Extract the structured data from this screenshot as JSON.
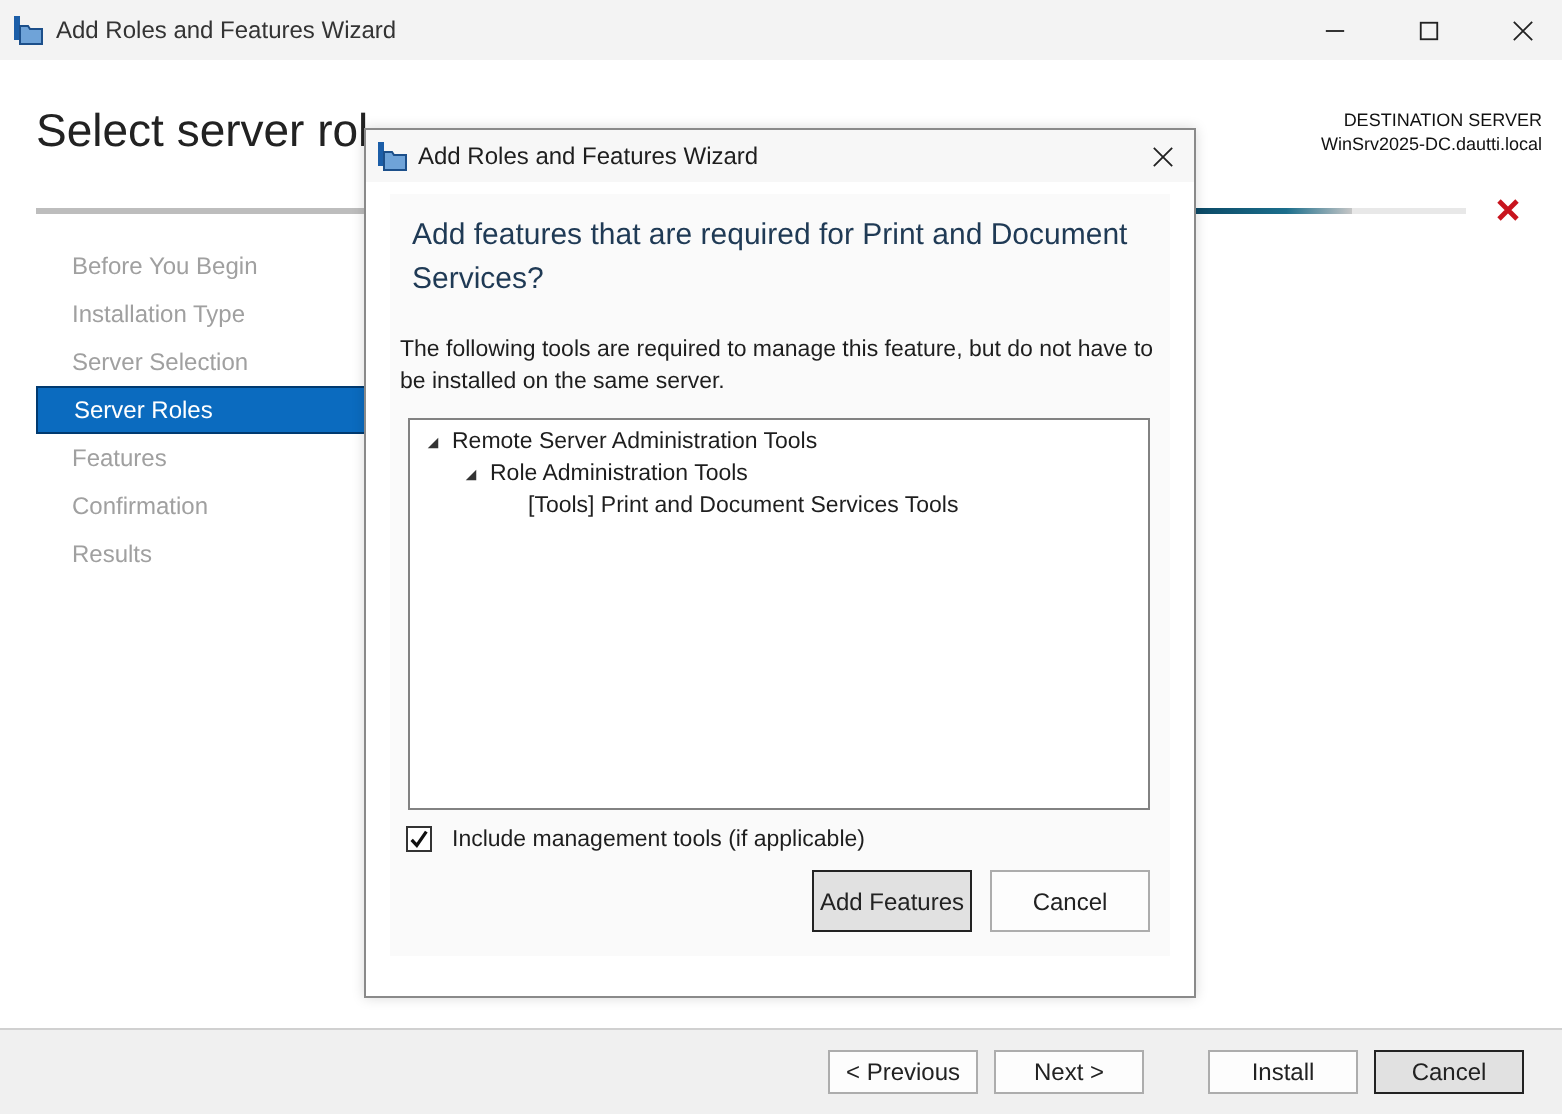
{
  "window": {
    "title": "Add Roles and Features Wizard"
  },
  "header": {
    "title": "Select server rol",
    "destination_label": "DESTINATION SERVER",
    "destination_server": "WinSrv2025-DC.dautti.local",
    "progress": {
      "level": 0.92
    }
  },
  "sidebar": {
    "items": [
      {
        "label": "Before You Begin",
        "selected": false
      },
      {
        "label": "Installation Type",
        "selected": false
      },
      {
        "label": "Server Selection",
        "selected": false
      },
      {
        "label": "Server Roles",
        "selected": true
      },
      {
        "label": "Features",
        "selected": false
      },
      {
        "label": "Confirmation",
        "selected": false
      },
      {
        "label": "Results",
        "selected": false
      }
    ]
  },
  "footer": {
    "buttons": [
      {
        "label": "< Previous",
        "default": false
      },
      {
        "label": "Next >",
        "default": false
      },
      {
        "label": "Install",
        "default": false
      },
      {
        "label": "Cancel",
        "default": true
      }
    ]
  },
  "dialog": {
    "title": "Add Roles and Features Wizard",
    "heading": "Add features that are required for Print and Document Services?",
    "description": "The following tools are required to manage this feature, but do not have to be installed on the same server.",
    "tree": [
      {
        "label": "Remote Server Administration Tools",
        "expanded": true,
        "children": [
          {
            "label": "Role Administration Tools",
            "expanded": true,
            "children": [
              {
                "label": "[Tools] Print and Document Services Tools",
                "expanded": false
              }
            ]
          }
        ]
      }
    ],
    "include_tools": {
      "label": "Include management tools (if applicable)",
      "checked": true
    },
    "buttons": [
      {
        "label": "Add Features",
        "default": true
      },
      {
        "label": "Cancel",
        "default": false
      }
    ]
  }
}
